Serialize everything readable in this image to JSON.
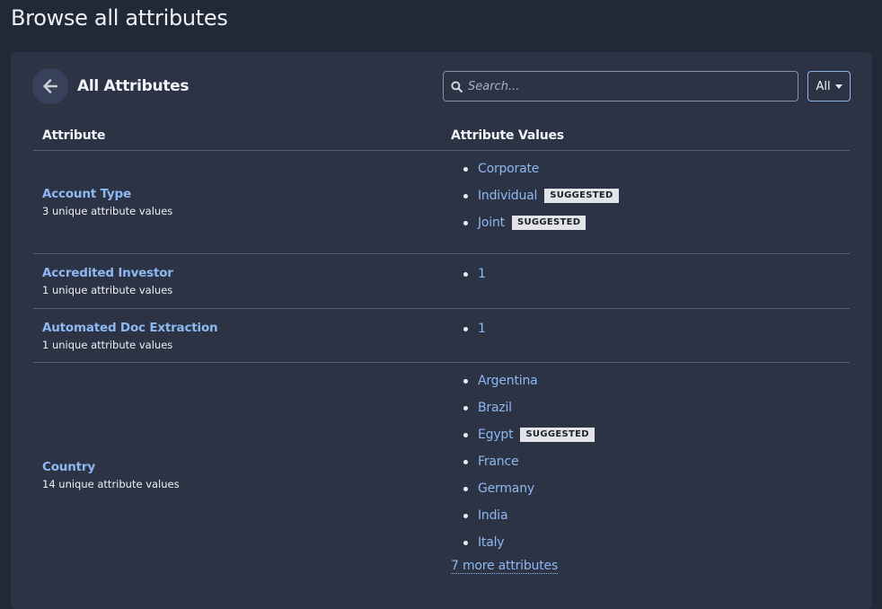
{
  "page": {
    "title": "Browse all attributes"
  },
  "panel": {
    "title": "All Attributes",
    "back_icon": "arrow-left-icon",
    "search": {
      "placeholder": "Search...",
      "value": "",
      "icon": "search-icon"
    },
    "filter": {
      "selected": "All",
      "icon": "caret-down-icon"
    }
  },
  "table": {
    "headers": [
      "Attribute",
      "Attribute Values"
    ],
    "suggested_label": "SUGGESTED",
    "rows": [
      {
        "name": "Account Type",
        "count": "3 unique attribute values",
        "values": [
          {
            "label": "Corporate",
            "suggested": false
          },
          {
            "label": "Individual",
            "suggested": true
          },
          {
            "label": "Joint",
            "suggested": true
          }
        ]
      },
      {
        "name": "Accredited Investor",
        "count": "1 unique attribute values",
        "values": [
          {
            "label": "1",
            "suggested": false
          }
        ]
      },
      {
        "name": "Automated Doc Extraction",
        "count": "1 unique attribute values",
        "values": [
          {
            "label": "1",
            "suggested": false
          }
        ]
      },
      {
        "name": "Country",
        "count": "14 unique attribute values",
        "values": [
          {
            "label": "Argentina",
            "suggested": false
          },
          {
            "label": "Brazil",
            "suggested": false
          },
          {
            "label": "Egypt",
            "suggested": true
          },
          {
            "label": "France",
            "suggested": false
          },
          {
            "label": "Germany",
            "suggested": false
          },
          {
            "label": "India",
            "suggested": false
          },
          {
            "label": "Italy",
            "suggested": false
          }
        ],
        "more_link": "7 more attributes"
      }
    ]
  },
  "colors": {
    "link": "#8fb8f2",
    "background": "#212836",
    "panel": "#2b3344",
    "badge": "#e2e4e8"
  }
}
